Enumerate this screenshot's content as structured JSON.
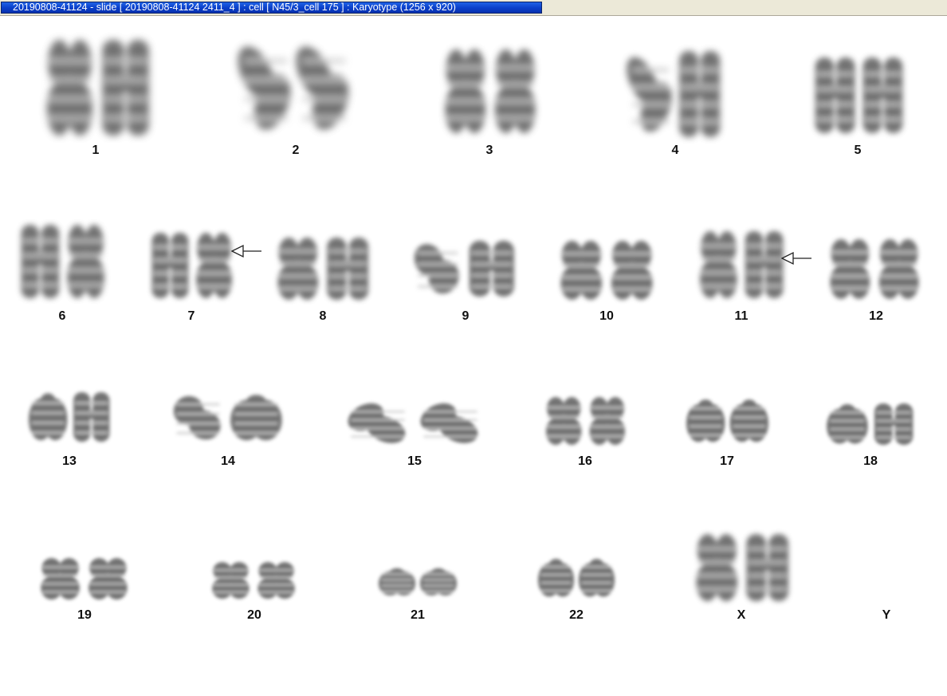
{
  "window": {
    "title": "20190808-41124 - slide [ 20190808-41124 2411_4 ] : cell [ N45/3_cell 175 ] : Karyotype  (1256 x 920)"
  },
  "karyotype": {
    "chromosome_color": "#5a5a5a",
    "labels": {
      "c1": "1",
      "c2": "2",
      "c3": "3",
      "c4": "4",
      "c5": "5",
      "c6": "6",
      "c7": "7",
      "c8": "8",
      "c9": "9",
      "c10": "10",
      "c11": "11",
      "c12": "12",
      "c13": "13",
      "c14": "14",
      "c15": "15",
      "c16": "16",
      "c17": "17",
      "c18": "18",
      "c19": "19",
      "c20": "20",
      "c21": "21",
      "c22": "22",
      "cX": "X",
      "cY": "Y"
    },
    "markers": [
      {
        "chromosome": "7",
        "icon": "arrow-left-icon"
      },
      {
        "chromosome": "11",
        "icon": "arrow-left-icon"
      }
    ]
  }
}
